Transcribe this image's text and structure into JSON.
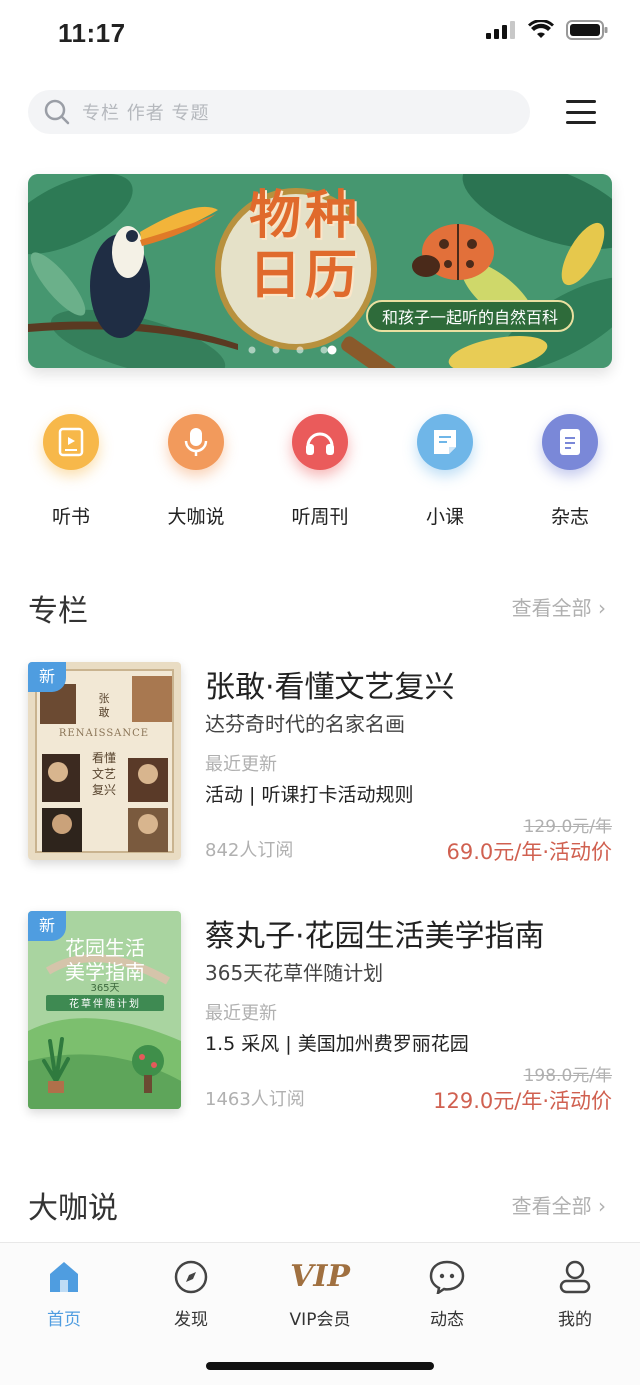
{
  "status_bar": {
    "time": "11:17"
  },
  "search": {
    "placeholder": "专栏 作者 专题"
  },
  "banner": {
    "title": "物种日历",
    "subtitle": "和孩子一起听的自然百科",
    "active_dot": 4,
    "dot_count": 5
  },
  "quick_nav": [
    {
      "label": "听书",
      "icon": "book-icon",
      "color": "#f7b84a"
    },
    {
      "label": "大咖说",
      "icon": "microphone-icon",
      "color": "#f29a5c"
    },
    {
      "label": "听周刊",
      "icon": "headphones-icon",
      "color": "#ea5b5b"
    },
    {
      "label": "小课",
      "icon": "notes-icon",
      "color": "#6fb6e8"
    },
    {
      "label": "杂志",
      "icon": "magazine-icon",
      "color": "#7a88d8"
    }
  ],
  "section_columns": {
    "title": "专栏",
    "see_all": "查看全部"
  },
  "cards": [
    {
      "badge": "新",
      "cover_text": "张敢 看懂文艺复兴",
      "cover_word": "RENAISSANCE",
      "title": "张敢·看懂文艺复兴",
      "subtitle": "达芬奇时代的名家名画",
      "update_label": "最近更新",
      "update": "活动 | 听课打卡活动规则",
      "readers": "842人订阅",
      "old_price": "129.0元/年",
      "price": "69.0元/年·活动价"
    },
    {
      "badge": "新",
      "cover_text": "花园生活美学指南",
      "cover_word": "365天",
      "cover_tag": "花草伴随计划",
      "title": "蔡丸子·花园生活美学指南",
      "subtitle": "365天花草伴随计划",
      "update_label": "最近更新",
      "update": "1.5 采风 | 美国加州费罗丽花园",
      "readers": "1463人订阅",
      "old_price": "198.0元/年",
      "price": "129.0元/年·活动价"
    }
  ],
  "section_talks": {
    "title": "大咖说",
    "see_all": "查看全部"
  },
  "tab_bar": [
    {
      "label": "首页",
      "icon": "home-icon",
      "active": true
    },
    {
      "label": "发现",
      "icon": "compass-icon",
      "active": false
    },
    {
      "label": "VIP会员",
      "icon": "vip-icon",
      "logo": "VIP",
      "active": false
    },
    {
      "label": "动态",
      "icon": "chat-bubble-icon",
      "active": false
    },
    {
      "label": "我的",
      "icon": "profile-icon",
      "active": false
    }
  ],
  "colors": {
    "accent": "#4f9de0",
    "price": "#d06050",
    "muted": "#b0b0b0"
  }
}
